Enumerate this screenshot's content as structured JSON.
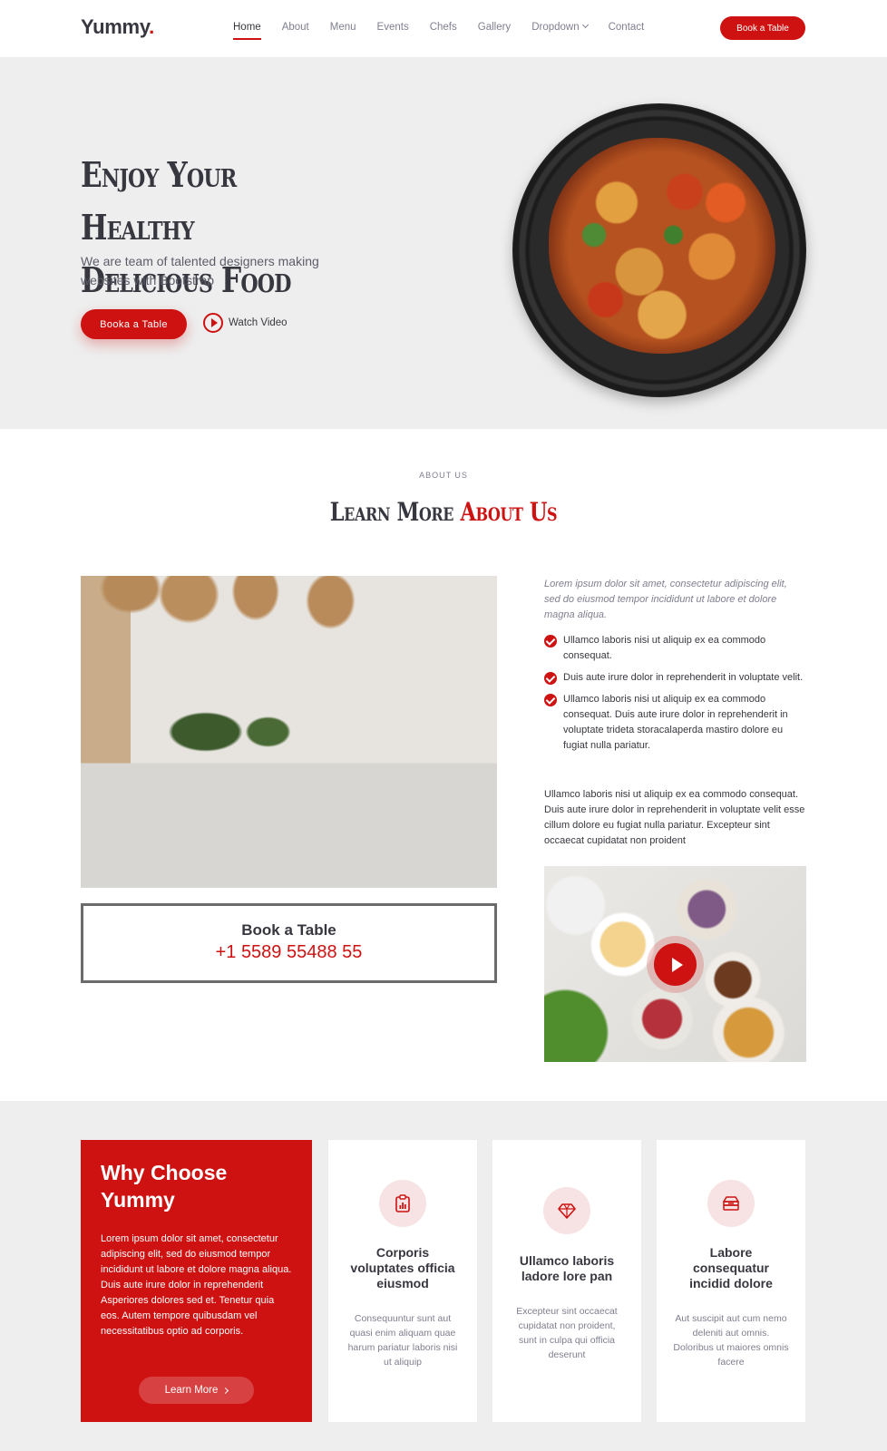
{
  "header": {
    "logo": "Yummy",
    "logo_dot": ".",
    "nav": [
      "Home",
      "About",
      "Menu",
      "Events",
      "Chefs",
      "Gallery",
      "Dropdown",
      "Contact"
    ],
    "book_button": "Book a Table"
  },
  "hero": {
    "title_line1": "Enjoy Your Healthy",
    "title_line2": "Delicious Food",
    "subtitle": "We are team of talented designers making websites with Bootstrap",
    "book_button": "Booka a Table",
    "watch_video": "Watch Video"
  },
  "about": {
    "label": "ABOUT US",
    "title_part1": "Learn More ",
    "title_part2": "About Us",
    "book_table_title": "Book a Table",
    "phone": "+1 5589 55488 55",
    "intro": "Lorem ipsum dolor sit amet, consectetur adipiscing elit, sed do eiusmod tempor incididunt ut labore et dolore magna aliqua.",
    "checks": [
      "Ullamco laboris nisi ut aliquip ex ea commodo consequat.",
      "Duis aute irure dolor in reprehenderit in voluptate velit.",
      "Ullamco laboris nisi ut aliquip ex ea commodo consequat. Duis aute irure dolor in reprehenderit in voluptate trideta storacalaperda mastiro dolore eu fugiat nulla pariatur."
    ],
    "body": "Ullamco laboris nisi ut aliquip ex ea commodo consequat. Duis aute irure dolor in reprehenderit in voluptate velit esse cillum dolore eu fugiat nulla pariatur. Excepteur sint occaecat cupidatat non proident"
  },
  "why": {
    "title": "Why Choose Yummy",
    "text": "Lorem ipsum dolor sit amet, consectetur adipiscing elit, sed do eiusmod tempor incididunt ut labore et dolore magna aliqua. Duis aute irure dolor in reprehenderit Asperiores dolores sed et. Tenetur quia eos. Autem tempore quibusdam vel necessitatibus optio ad corporis.",
    "learn_more": "Learn More",
    "cards": [
      {
        "title": "Corporis voluptates officia eiusmod",
        "text": "Consequuntur sunt aut quasi enim aliquam quae harum pariatur laboris nisi ut aliquip"
      },
      {
        "title": "Ullamco laboris ladore lore pan",
        "text": "Excepteur sint occaecat cupidatat non proident, sunt in culpa qui officia deserunt"
      },
      {
        "title": "Labore consequatur incidid dolore",
        "text": "Aut suscipit aut cum nemo deleniti aut omnis. Doloribus ut maiores omnis facere"
      }
    ]
  },
  "colors": {
    "accent": "#ce1212",
    "text": "#37373f",
    "muted": "#7f7f90",
    "section_bg": "#eeeeee"
  }
}
